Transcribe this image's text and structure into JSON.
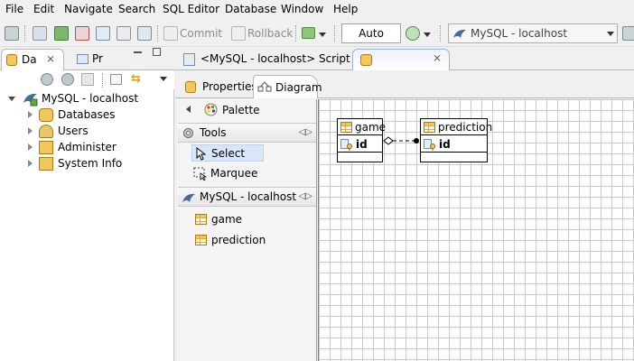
{
  "menu": [
    "File",
    "Edit",
    "Navigate",
    "Search",
    "SQL Editor",
    "Database",
    "Window",
    "Help"
  ],
  "toolbar": {
    "commit_label": "Commit",
    "rollback_label": "Rollback",
    "mode_value": "Auto",
    "connection_value": "MySQL - localhost"
  },
  "left_panel": {
    "tabs": [
      "Da",
      "Pr"
    ],
    "tree": {
      "root": "MySQL - localhost",
      "children": [
        "Databases",
        "Users",
        "Administer",
        "System Info"
      ]
    }
  },
  "editor": {
    "tabs": [
      "<MySQL - localhost> Script"
    ],
    "sub_tabs": [
      "Properties",
      "Diagram"
    ]
  },
  "palette": {
    "title": "Palette",
    "tools_title": "Tools",
    "tools": [
      "Select",
      "Marquee"
    ],
    "connection_title": "MySQL - localhost",
    "tables": [
      "game",
      "prediction"
    ]
  },
  "diagram": {
    "entities": [
      {
        "name": "game",
        "columns": [
          "id"
        ]
      },
      {
        "name": "prediction",
        "columns": [
          "id"
        ]
      }
    ]
  },
  "colors": {
    "selection": "#dae6f7",
    "table_icon": "#f3c85b"
  }
}
